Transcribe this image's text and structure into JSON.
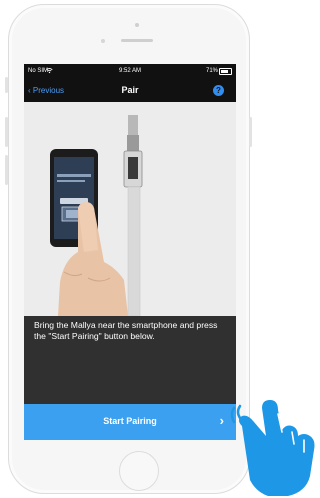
{
  "status_bar": {
    "carrier": "No SIM",
    "time": "9:52 AM",
    "battery": "71%"
  },
  "nav": {
    "back_label": "Previous",
    "title": "Pair",
    "help_label": "?"
  },
  "instruction": "Bring the Mallya near the smartphone and press the \"Start Pairing\" button below.",
  "cta": {
    "label": "Start Pairing",
    "chevron": "›"
  },
  "colors": {
    "accent": "#3ba0f0",
    "nav_link": "#4a9df8",
    "screen_bg": "#303030",
    "bar_bg": "#111111"
  },
  "icons": [
    "wifi-icon",
    "battery-icon",
    "chevron-left-icon",
    "help-icon",
    "chevron-right-icon",
    "pointing-hand-icon"
  ]
}
